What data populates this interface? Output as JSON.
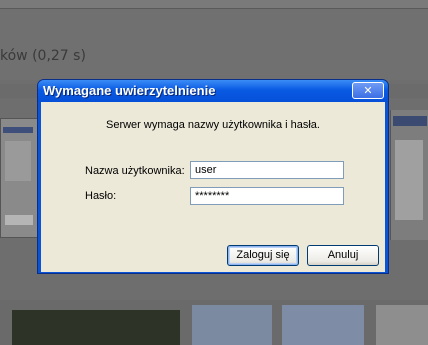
{
  "background": {
    "status_text": "ków (0,27 s)"
  },
  "dialog": {
    "title": "Wymagane uwierzytelnienie",
    "close_symbol": "✕",
    "message": "Serwer  wymaga nazwy użytkownika i hasła.",
    "username_label": "Nazwa użytkownika:",
    "username_value": "user",
    "password_label": "Hasło:",
    "password_value": "********",
    "login_button": "Zaloguj się",
    "cancel_button": "Anuluj"
  },
  "colors": {
    "titlebar": "#0a5ae3",
    "client": "#ece9d8",
    "field_border": "#7f9db9"
  }
}
